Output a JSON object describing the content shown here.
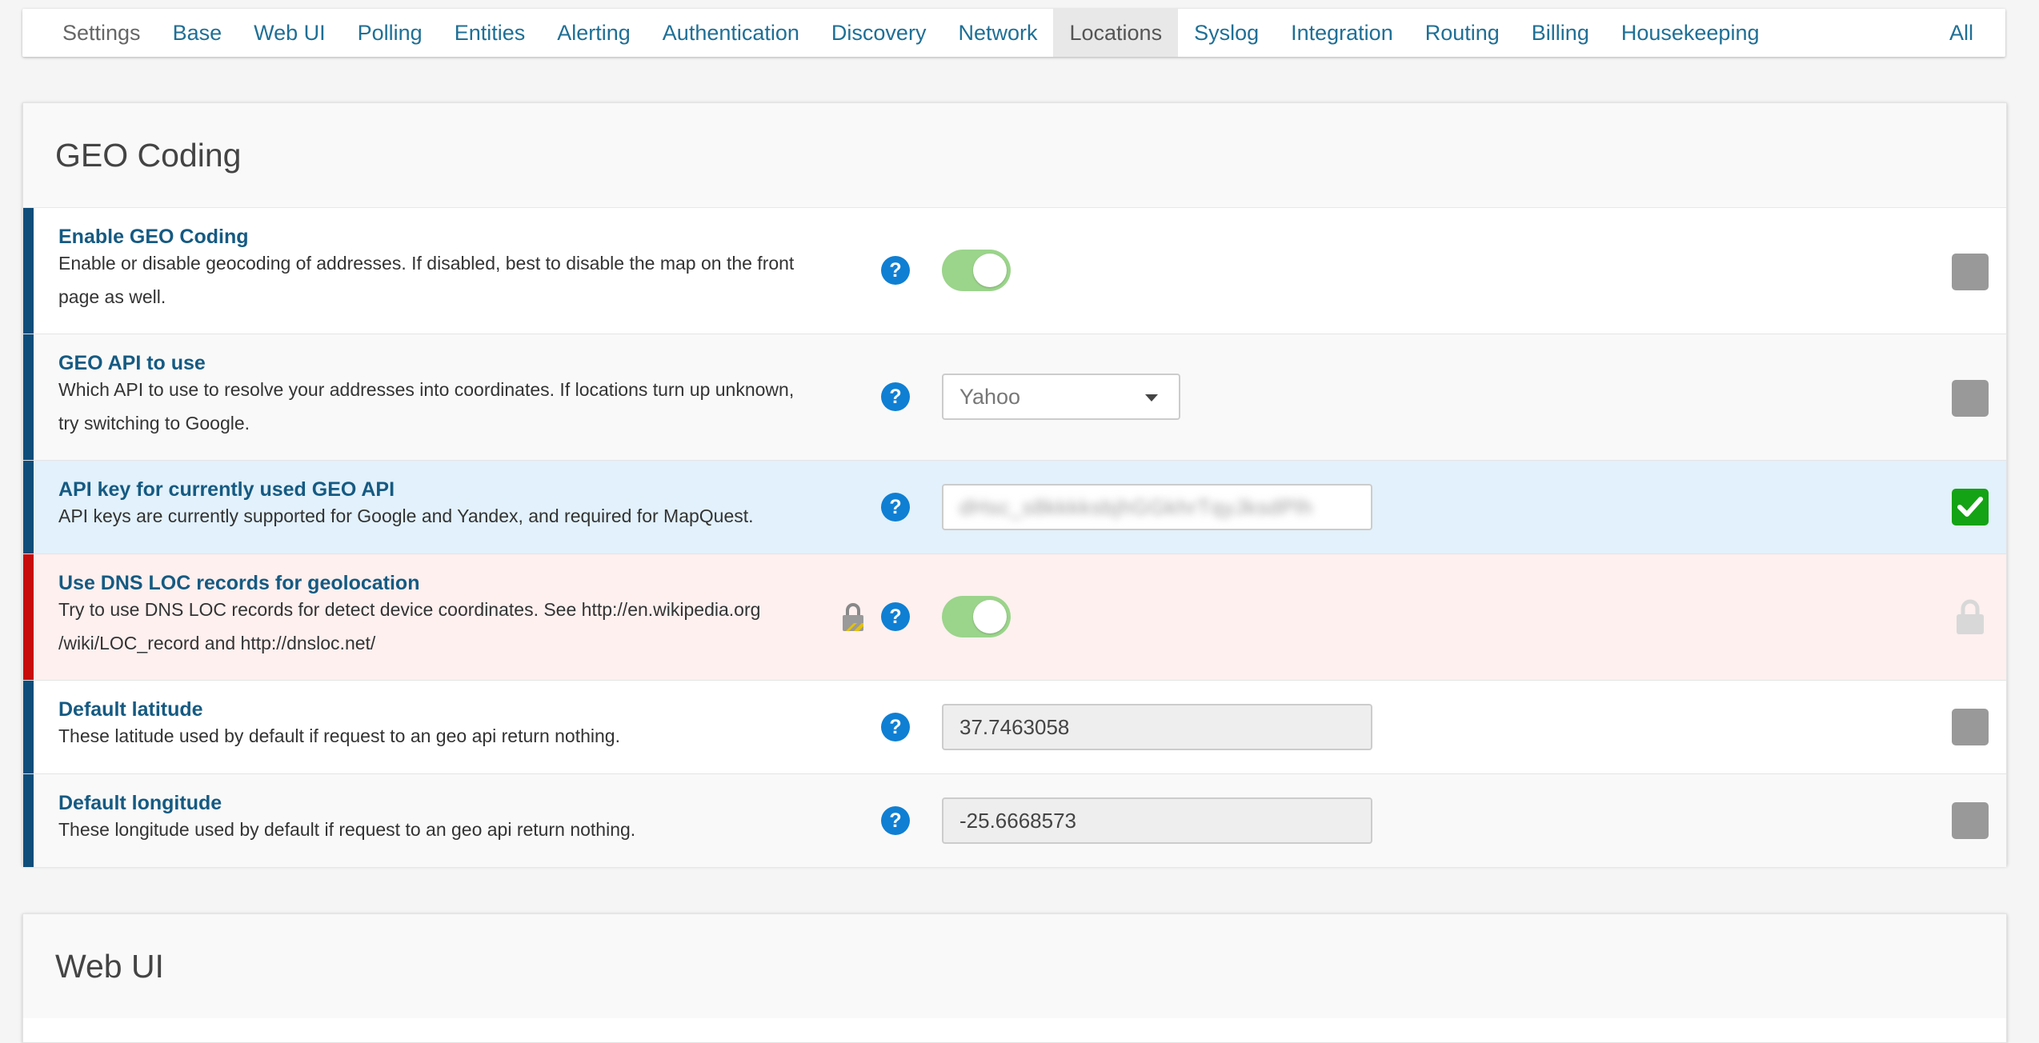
{
  "nav": {
    "brand": "Settings",
    "items": [
      "Base",
      "Web UI",
      "Polling",
      "Entities",
      "Alerting",
      "Authentication",
      "Discovery",
      "Network",
      "Locations",
      "Syslog",
      "Integration",
      "Routing",
      "Billing",
      "Housekeeping"
    ],
    "active": "Locations",
    "right": "All"
  },
  "section1": {
    "title": "GEO Coding",
    "rows": [
      {
        "title": "Enable GEO Coding",
        "desc": "Enable or disable geocoding of addresses. If disabled, best to disable the map on the front page as well.",
        "control": "toggle",
        "state": "on",
        "checkbox": false
      },
      {
        "title": "GEO API to use",
        "desc": "Which API to use to resolve your addresses into coordinates. If locations turn up unknown, try switching to Google.",
        "control": "select",
        "value": "Yahoo",
        "checkbox": false
      },
      {
        "title": "API key for currently used GEO API",
        "desc": "API keys are currently supported for Google and Yandex, and required for MapQuest.",
        "control": "text",
        "value": "dHsc_s8kkkksbjhGGkhrTqyJksdPlh",
        "checkbox": true
      },
      {
        "title": "Use DNS LOC records for geolocation",
        "desc": "Try to use DNS LOC records for detect device coordinates. See http://en.wikipedia.org /wiki/LOC_record and http://dnsloc.net/",
        "control": "toggle",
        "state": "on",
        "locked": true
      },
      {
        "title": "Default latitude",
        "desc": "These latitude used by default if request to an geo api return nothing.",
        "control": "text",
        "value": "37.7463058",
        "checkbox": false
      },
      {
        "title": "Default longitude",
        "desc": "These longitude used by default if request to an geo api return nothing.",
        "control": "text",
        "value": "-25.6668573",
        "checkbox": false
      }
    ]
  },
  "section2": {
    "title": "Web UI"
  },
  "help_glyph": "?",
  "colors": {
    "link": "#155a82",
    "bar": "#0e4d7a",
    "bar_locked": "#c80c0c",
    "toggle_on": "#9bd48b",
    "help": "#0f7fd3",
    "check_on": "#14a314"
  }
}
